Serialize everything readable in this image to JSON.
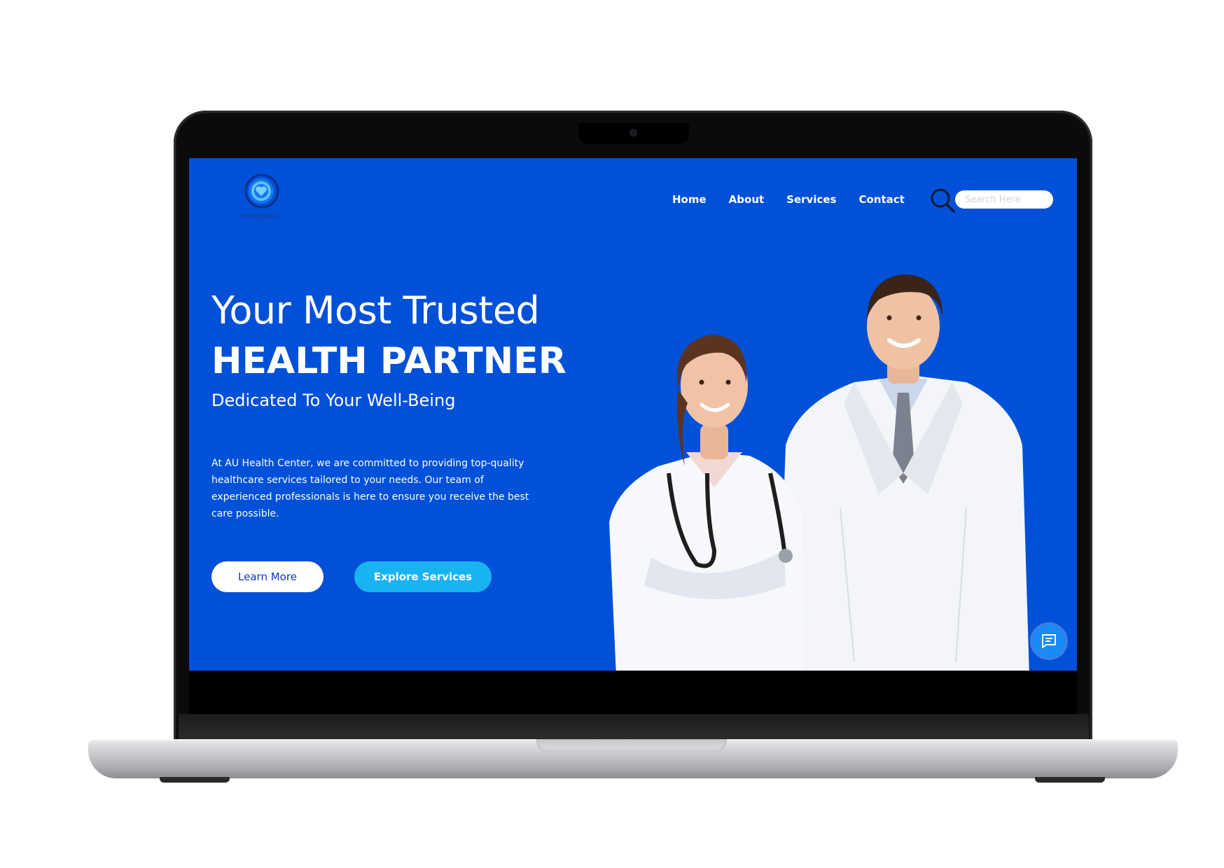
{
  "brand": {
    "name": "MedSphere Ai"
  },
  "nav": {
    "items": [
      {
        "label": "Home"
      },
      {
        "label": "About"
      },
      {
        "label": "Services"
      },
      {
        "label": "Contact"
      }
    ],
    "search_placeholder": "Search Here"
  },
  "hero": {
    "line1": "Your Most Trusted",
    "line2": "HEALTH PARTNER",
    "subtitle": "Dedicated To Your Well-Being",
    "body": "At AU Health Center, we are committed to providing top-quality healthcare services tailored to your needs. Our team of experienced professionals is here to ensure you receive the best care possible.",
    "learn_more": "Learn More",
    "explore_services": "Explore Services"
  },
  "colors": {
    "background": "#0050d8",
    "accent_button": "#19b3f2",
    "chat_button": "#1a8af5"
  },
  "icons": {
    "logo": "heart-circle-icon",
    "search": "search-icon",
    "chat": "chat-icon"
  }
}
